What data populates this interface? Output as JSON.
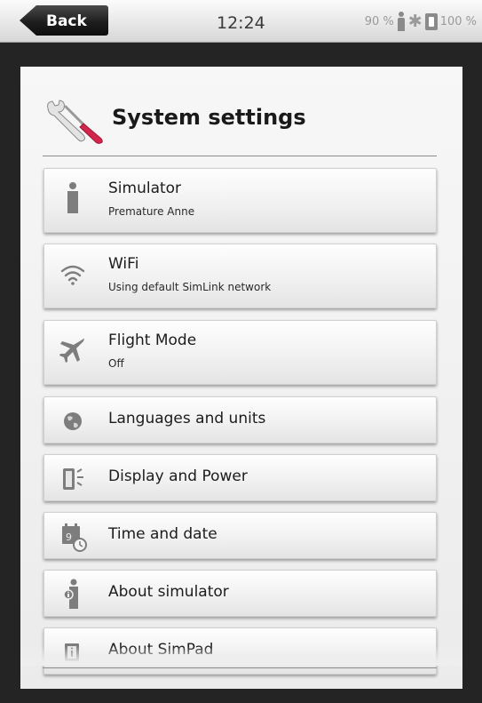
{
  "status_bar": {
    "back_label": "Back",
    "time": "12:24",
    "signal_level": "90 %",
    "battery_level": "100 %"
  },
  "page": {
    "title": "System settings"
  },
  "settings": [
    {
      "title": "Simulator",
      "subtitle": "Premature Anne",
      "icon": "person-icon"
    },
    {
      "title": "WiFi",
      "subtitle": "Using default SimLink network",
      "icon": "wifi-icon"
    },
    {
      "title": "Flight Mode",
      "subtitle": "Off",
      "icon": "airplane-icon"
    },
    {
      "title": "Languages and units",
      "icon": "globe-icon"
    },
    {
      "title": "Display and Power",
      "icon": "display-power-icon"
    },
    {
      "title": "Time and date",
      "icon": "calendar-clock-icon"
    },
    {
      "title": "About simulator",
      "icon": "info-person-icon"
    },
    {
      "title": "About SimPad",
      "icon": "info-device-icon"
    }
  ],
  "colors": {
    "background": "#242424",
    "panel": "#f2f2f2",
    "back_button": "#1e1e1e",
    "screwdriver_handle": "#d4254c"
  }
}
